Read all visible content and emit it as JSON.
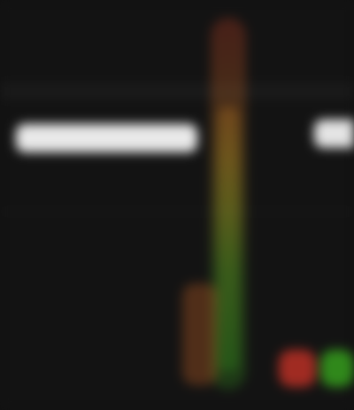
{
  "screen": {
    "title": "",
    "left_label": "",
    "right_label": ""
  },
  "indicators": {
    "meter_name": "",
    "status_red": "",
    "status_green": ""
  },
  "palette": {
    "background": "#131313",
    "panel_band": "#1a1a1a",
    "label_fill": "#e9e9e9",
    "meter_top": "#ff4d2a",
    "meter_mid": "#d9d02a",
    "meter_bottom": "#41c021",
    "status_red": "#ff3c2d",
    "status_green": "#41c821"
  },
  "icons": {
    "left_status": "status-dot-red-icon",
    "right_status": "status-dot-green-icon",
    "meter": "level-meter-icon"
  }
}
